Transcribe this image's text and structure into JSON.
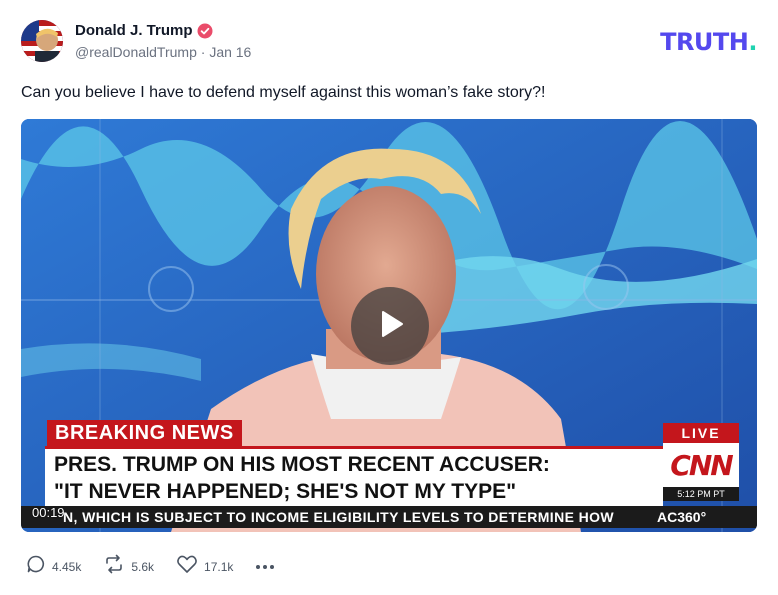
{
  "post": {
    "author_name": "Donald J. Trump",
    "handle": "@realDonaldTrump",
    "separator": "·",
    "date": "Jan 16",
    "text": "Can you believe I have to defend myself against this woman’s fake story?!"
  },
  "brand": {
    "logo_text": "TRUTH",
    "logo_dot": "."
  },
  "video": {
    "elapsed": "00:19",
    "breaking_label": "BREAKING NEWS",
    "headline_line1": "PRES. TRUMP ON HIS MOST RECENT ACCUSER:",
    "headline_line2": "\"IT NEVER HAPPENED; SHE'S NOT MY TYPE\"",
    "live_label": "LIVE",
    "network_logo": "CNN",
    "broadcast_time": "5:12 PM PT",
    "ticker_text": "N, WHICH IS SUBJECT TO INCOME ELIGIBILITY LEVELS TO DETERMINE HOW",
    "show_name": "AC360°"
  },
  "actions": {
    "replies": "4.45k",
    "retruths": "5.6k",
    "likes": "17.1k"
  },
  "colors": {
    "brand_purple": "#5448ee",
    "brand_teal": "#1fd3b0",
    "verified_pink": "#ea4c6a",
    "cnn_red": "#c4161c"
  },
  "icons": [
    "avatar",
    "verified-badge-icon",
    "play-icon",
    "reply-icon",
    "retruth-icon",
    "like-icon",
    "more-icon"
  ]
}
